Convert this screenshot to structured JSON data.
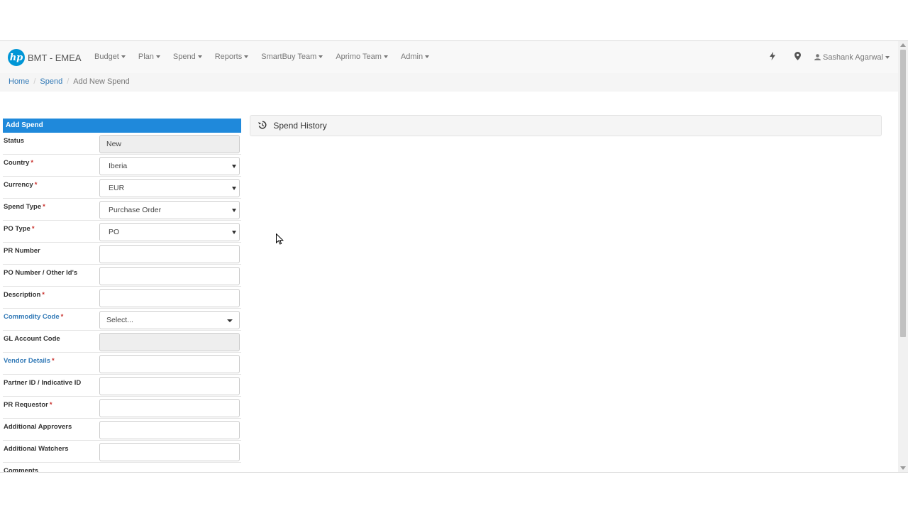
{
  "brand": {
    "logo_text": "hp",
    "title": "BMT - EMEA"
  },
  "nav": {
    "items": [
      "Budget",
      "Plan",
      "Spend",
      "Reports",
      "SmartBuy Team",
      "Aprimo Team",
      "Admin"
    ],
    "bolt_icon": "bolt-icon",
    "marker_icon": "map-marker-icon",
    "user": "Sashank Agarwal"
  },
  "breadcrumb": [
    "Home",
    "Spend",
    "Add New Spend"
  ],
  "form": {
    "title": "Add Spend",
    "fields": [
      {
        "label": "Status",
        "value": "New",
        "type": "readonly",
        "required": false
      },
      {
        "label": "Country",
        "value": "Iberia",
        "type": "select",
        "required": true
      },
      {
        "label": "Currency",
        "value": "EUR",
        "type": "select",
        "required": true
      },
      {
        "label": "Spend Type",
        "value": "Purchase Order",
        "type": "select",
        "required": true
      },
      {
        "label": "PO Type",
        "value": "PO",
        "type": "select",
        "required": true
      },
      {
        "label": "PR Number",
        "value": "",
        "type": "text",
        "required": false
      },
      {
        "label": "PO Number / Other Id's",
        "value": "",
        "type": "text",
        "required": false
      },
      {
        "label": "Description",
        "value": "",
        "type": "text",
        "required": true
      },
      {
        "label": "Commodity Code",
        "value": "Select...",
        "type": "select2",
        "required": true,
        "link": true
      },
      {
        "label": "GL Account Code",
        "value": "",
        "type": "disabled",
        "required": false
      },
      {
        "label": "Vendor Details",
        "value": "",
        "type": "text",
        "required": true,
        "link": true
      },
      {
        "label": "Partner ID / Indicative ID",
        "value": "",
        "type": "text",
        "required": false
      },
      {
        "label": "PR Requestor",
        "value": "",
        "type": "text",
        "required": true
      },
      {
        "label": "Additional Approvers",
        "value": "",
        "type": "text",
        "required": false
      },
      {
        "label": "Additional Watchers",
        "value": "",
        "type": "text",
        "required": false
      },
      {
        "label": "Comments",
        "value": null,
        "type": "none",
        "required": false
      }
    ]
  },
  "history": {
    "title": "Spend History",
    "icon": "history-icon"
  },
  "colors": {
    "accent": "#1f89db",
    "link": "#337ab7",
    "required": "#c9302c",
    "hp_blue": "#0096d6"
  }
}
